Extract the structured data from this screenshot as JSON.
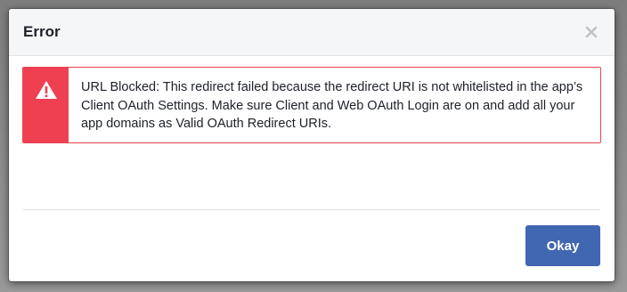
{
  "dialog": {
    "title": "Error",
    "close_icon": "close-icon",
    "alert": {
      "icon": "warning-icon",
      "accent_color": "#ee4050",
      "message": "URL Blocked: This redirect failed because the redirect URI is not whitelisted in the app’s Client OAuth Settings. Make sure Client and Web OAuth Login are on and add all your app domains as Valid OAuth Redirect URIs."
    },
    "footer": {
      "okay_label": "Okay",
      "button_color": "#4267b2"
    }
  }
}
